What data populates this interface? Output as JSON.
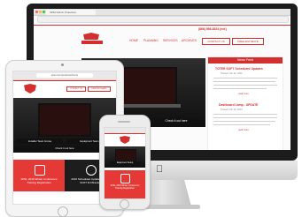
{
  "desktop": {
    "tab_label": "SPEI Fabric Protection",
    "phone": "(866) 866-8324 (ext.)",
    "nav": [
      "HOME",
      "PLANNING",
      "SERVICES",
      "ARCHIVES"
    ],
    "nav_buttons": [
      "CONTACT US",
      "FREE ESTIMATE"
    ],
    "hero_caption_left": "Install Team - Equipment Setup",
    "hero_caption_right": "Check it out here",
    "sidebar": {
      "heading": "News Feed",
      "items": [
        {
          "title": "TOTER SOFT Scheduled Updates",
          "date": "Posted: Feb 22, 2016",
          "body": "We have just updated our SOFT TOTER Scheduled for IE, CX Router and IE7 Tulla Switch. Please visit our SIT CS support downloads page for more info.",
          "link": "read more"
        },
        {
          "title": "Dashboard Lamp - UPDATE",
          "date": "Posted: Feb 22, 2016",
          "body": "Dashboard Lamp - HIGHER REGISTER - The Dashboard Lamp has been updated and be available in a software at all out BARBOB. We hope this update will be of help.",
          "link": "read more"
        }
      ]
    }
  },
  "tablet": {
    "url": "spei.com/products/home",
    "hero_caption_left": "Installer Team Grows",
    "hero_caption_right": "Equipment Team",
    "hero_caption_extra": "Check it out here",
    "tile_red": "SPEI, 2016 Winter Conference Training Registration",
    "tile_dark": "2016 Scheduled Updated - 2016 SOFT RJ Bracket"
  },
  "phone": {
    "hero_caption": "Equipment Setup",
    "tile_red": "SPEI, 2016 Winter Conference Training Registration"
  },
  "colors": {
    "brand_red": "#d32f2f",
    "dark": "#111111"
  }
}
